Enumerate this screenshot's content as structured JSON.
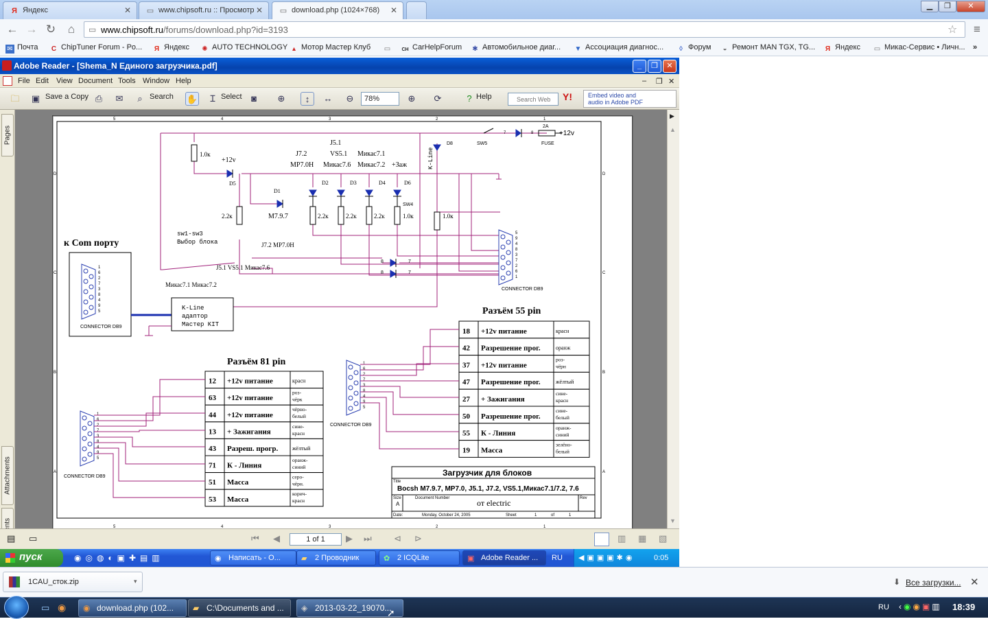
{
  "browser": {
    "tabs": [
      {
        "label": "Яндекс",
        "active": false
      },
      {
        "label": "www.chipsoft.ru :: Просмотр",
        "active": false
      },
      {
        "label": "download.php (1024×768)",
        "active": true
      }
    ],
    "url_host": "www.chipsoft.ru",
    "url_path": "/forums/download.php?id=3193",
    "bookmarks": [
      "Почта",
      "ChipTuner Forum - Po...",
      "Яндекс",
      "AUTO TECHNOLOGY",
      "Мотор Мастер Клуб",
      "CarHelpForum",
      "Автомобильное диаг...",
      "Ассоциация диагнос...",
      "Форум",
      "Ремонт MAN TGX, TG...",
      "Яндекс",
      "Микас-Сервис • Личн..."
    ]
  },
  "reader": {
    "title": "Adobe Reader - [Shema_N Единого загрузчика.pdf]",
    "menu": [
      "File",
      "Edit",
      "View",
      "Document",
      "Tools",
      "Window",
      "Help"
    ],
    "toolbar": {
      "save_copy": "Save a Copy",
      "search": "Search",
      "select": "Select",
      "zoom": "78%",
      "help": "Help",
      "search_web_placeholder": "Search Web",
      "embed_line1": "Embed video and",
      "embed_line2": "audio in Adobe PDF"
    },
    "side_tabs": [
      "Pages",
      "Attachments",
      "Comments"
    ],
    "page_indicator": "1 of 1"
  },
  "schematic": {
    "border_numbers": [
      "5",
      "4",
      "3",
      "2",
      "1"
    ],
    "border_letters": [
      "D",
      "C",
      "B",
      "A"
    ],
    "com_port": "к Com порту",
    "connector_label": "CONNECTOR DB9",
    "kline_adapter": [
      "K-Line",
      "адаптор",
      "Мастер KIT"
    ],
    "sw_block": [
      "sw1-sw3",
      "Выбор блока"
    ],
    "sw_labels": {
      "sw5": "SW5",
      "sw4": "SW4",
      "fuse": "FUSE",
      "fuse_rating": "2A",
      "pin7": "7",
      "pin8": "8",
      "d8": "D8",
      "kline": "K-Line"
    },
    "plus12v": "+12v",
    "resistors": {
      "r1": "1.0к",
      "r22": "2.2к",
      "r10": "1.0к"
    },
    "diodes": [
      "D5",
      "D1",
      "D2",
      "D3",
      "D4",
      "D6"
    ],
    "ecu_labels": {
      "j72": "J7.2",
      "mp70h": "МР7.0Н",
      "j51": "J5.1",
      "vs51": "VS5.1",
      "mikas71": "Микас7.1",
      "mikas76": "Микас7.6",
      "mikas72": "Микас7.2",
      "plus_zazh": "+Заж",
      "m797": "M7.9.7"
    },
    "switch_rows": [
      "J7.2  МР7.0Н",
      "J5.1  VS5.1  Микас7.6",
      "Микас7.1 Микас7.2"
    ],
    "header55": "Разъём 55 pin",
    "table55": [
      [
        "18",
        "+12v питание",
        "красн"
      ],
      [
        "42",
        "Разрешение прог.",
        "оранж"
      ],
      [
        "37",
        "+12v питание",
        "роз-чёрн"
      ],
      [
        "47",
        "Разрешение прог.",
        "жёлтый"
      ],
      [
        "27",
        "+ Зажигания",
        "сине-красн"
      ],
      [
        "50",
        "Разрешение прог.",
        "сине-белый"
      ],
      [
        "55",
        "К - Линия",
        "оранж-синий"
      ],
      [
        "19",
        "Масса",
        "зелёно-белый"
      ]
    ],
    "header81": "Разъём 81 pin",
    "table81": [
      [
        "12",
        "+12v питание",
        "красн"
      ],
      [
        "63",
        "+12v питание",
        "роз-чёрк"
      ],
      [
        "44",
        "+12v питание",
        "чёрно-белый"
      ],
      [
        "13",
        "+ Зажигания",
        "сине-красн"
      ],
      [
        "43",
        "Разреш. прогр.",
        "жёлтый"
      ],
      [
        "71",
        "К - Линия",
        "оранж-синий"
      ],
      [
        "51",
        "Масса",
        "серо-чёрн."
      ],
      [
        "53",
        "Масса",
        "корич-красн"
      ]
    ],
    "titleblock": {
      "heading": "Загрузчик для блоков",
      "title_label": "Title",
      "title": "Bocsh M7.9.7, MP7.0, J5.1, J7.2, VS5.1,Микас7.1/7.2, 7.6",
      "size_label": "Size",
      "size": "A",
      "docnum_label": "Document Number",
      "docnum": "от   electric",
      "rev_label": "Rev",
      "date_label": "Date:",
      "date": "Monday, October 24, 2005",
      "sheet_label": "Sheet",
      "sheet": "1",
      "of_label": "of",
      "of": "1"
    }
  },
  "xp_taskbar": {
    "start": "пуск",
    "tasks": [
      "Написать - О...",
      "2 Проводник",
      "2 ICQLite",
      "Adobe Reader ..."
    ],
    "lang": "RU",
    "clock": "0:05"
  },
  "downloads": {
    "file": "1CAU_сток.zip",
    "all": "Все загрузки..."
  },
  "win7": {
    "tasks": [
      "download.php (102...",
      "C:\\Documents and ...",
      "2013-03-22_19070..."
    ],
    "lang": "RU",
    "clock": "18:39"
  }
}
